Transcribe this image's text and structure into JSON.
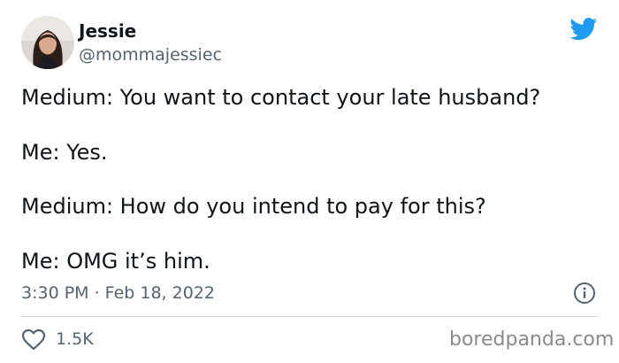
{
  "tweet": {
    "author": {
      "display_name": "Jessie",
      "handle": "@mommajessiec",
      "avatar_icon": "profile-photo"
    },
    "brand_icon": "twitter-bird-icon",
    "brand_color": "#1d9bf0",
    "lines": [
      "Medium: You want to contact your late husband?",
      "Me: Yes.",
      "Medium: How do you intend to pay for this?",
      "Me: OMG it’s him."
    ],
    "timestamp": "3:30 PM · Feb 18, 2022",
    "info_icon": "info-icon",
    "likes": {
      "icon": "heart-icon",
      "count": "1.5K"
    }
  },
  "watermark": "boredpanda.com"
}
